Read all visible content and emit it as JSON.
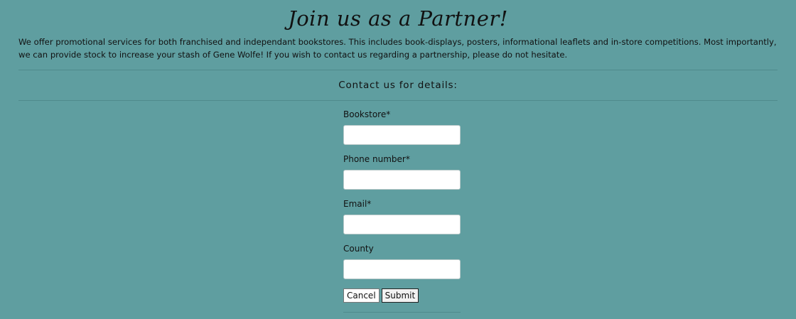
{
  "page": {
    "title": "Join us as a Partner!",
    "intro": "We offer promotional services for both franchised and independant bookstores. This includes book-displays, posters, informational leaflets and in-store competitions. Most importantly, we can provide stock to increase your stash of Gene Wolfe! If you wish to contact us regarding a partnership, please do not hesitate.",
    "contact_heading": "Contact us for details:"
  },
  "form": {
    "fields": [
      {
        "label": "Bookstore*",
        "value": "",
        "placeholder": ""
      },
      {
        "label": "Phone number*",
        "value": "",
        "placeholder": ""
      },
      {
        "label": "Email*",
        "value": "",
        "placeholder": ""
      },
      {
        "label": "County",
        "value": "",
        "placeholder": ""
      }
    ],
    "cancel_label": "Cancel",
    "submit_label": "Submit"
  },
  "colors": {
    "background": "#5f9ea0",
    "text": "#111111",
    "input_background": "#ffffff"
  }
}
